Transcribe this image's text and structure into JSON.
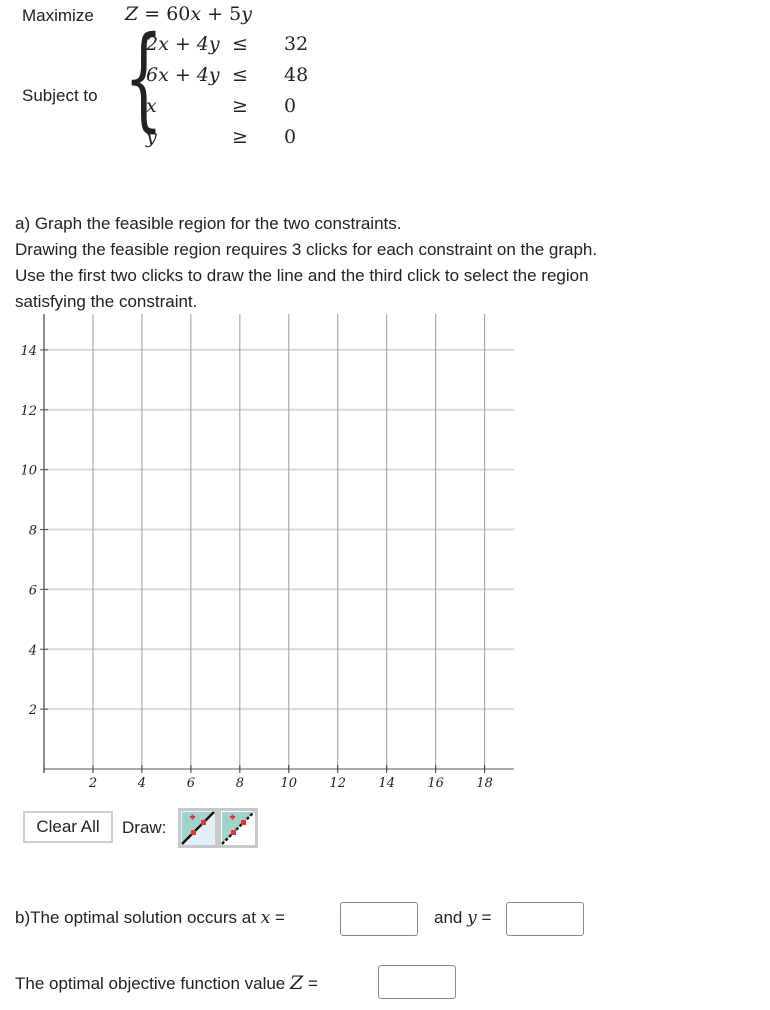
{
  "problem": {
    "maximize_label": "Maximize",
    "objective": {
      "lhs": "Z",
      "eq": "=",
      "terms": [
        "60",
        "x",
        "+",
        "5",
        "y"
      ]
    },
    "subject_to_label": "Subject to",
    "constraints": [
      {
        "lhs": "2x + 4y",
        "op": "≤",
        "rhs": "32"
      },
      {
        "lhs": "6x + 4y",
        "op": "≤",
        "rhs": "48"
      },
      {
        "lhs": "x",
        "op": "≥",
        "rhs": "0"
      },
      {
        "lhs": "y",
        "op": "≥",
        "rhs": "0"
      }
    ]
  },
  "part_a": {
    "lines": [
      "a) Graph the feasible region for the two constraints.",
      "Drawing the feasible region requires 3 clicks for each constraint on the graph.",
      "Use the first two clicks to draw the line and the third click to select the region",
      "satisfying the constraint."
    ]
  },
  "graph": {
    "x_ticks": [
      "2",
      "4",
      "6",
      "8",
      "10",
      "12",
      "14",
      "16",
      "18"
    ],
    "y_ticks": [
      "2",
      "4",
      "6",
      "8",
      "10",
      "12",
      "14"
    ],
    "x_range": [
      0,
      19.2
    ],
    "y_range": [
      0,
      15.2
    ],
    "grid_step": 2,
    "colors": {
      "axis": "#444444",
      "vgrid": "#9a9a9a",
      "hgrid": "#d9d9d9"
    }
  },
  "toolbar": {
    "clear_all_label": "Clear All",
    "draw_label": "Draw:",
    "tools": [
      {
        "name": "solid-line-region-tool",
        "selected": true
      },
      {
        "name": "dashed-line-region-tool",
        "selected": false
      }
    ],
    "colors": {
      "region": "#9fd3cc",
      "point": "#e8322e",
      "selected_bg": "#e4eef7"
    }
  },
  "part_b": {
    "prefix": "b)The optimal solution occurs at",
    "x_var": "x",
    "eq": "=",
    "and_label": "and",
    "y_var": "y",
    "x_value": "",
    "y_value": ""
  },
  "objective_answer": {
    "label": "The optimal objective function value",
    "var": "Z",
    "eq": "=",
    "value": ""
  }
}
